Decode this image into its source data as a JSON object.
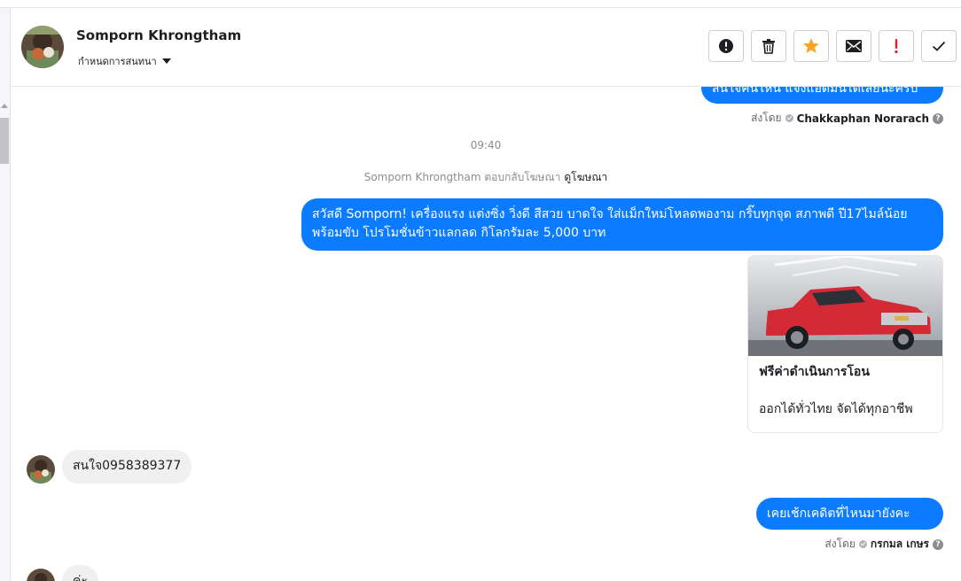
{
  "header": {
    "name": "Somporn Khrongtham",
    "assign_label": "กำหนดการสนทนา",
    "actions": [
      {
        "icon": "exclamation-circle-icon"
      },
      {
        "icon": "trash-icon"
      },
      {
        "icon": "star-icon",
        "color": "#f5a623"
      },
      {
        "icon": "envelope-icon"
      },
      {
        "icon": "exclamation-icon",
        "color": "#e02020"
      },
      {
        "icon": "checkmark-icon"
      }
    ]
  },
  "messages": {
    "top_partial": "สนใจคันไหน แจ้งแอดมินได้เลยนะครับ",
    "top_sentby_prefix": "ส่งโดย",
    "top_sentby_name": "Chakkaphan Norarach",
    "time": "09:40",
    "ad_reply_text": "Somporn Khrongtham ตอบกลับโฆษณา",
    "ad_reply_link": "ดูโฆษณา",
    "ad_message": "สวัสดี Somporn! เครื่องแรง แต่งซิ่ง วิ่งดี สีสวย บาดใจ ใส่แม็กใหม่โหลดพองาม กริ๊บทุกจุด สภาพดี ปี17ไมล์น้อย พร้อมขับ โปรโมชั่นข้าวแลกลด กิโลกรัมละ 5,000 บาท",
    "card_title": "ฟรีค่าดำเนินการโอน",
    "card_subtitle": "ออกได้ทั่วไทย จัดได้ทุกอาชีพ",
    "incoming_1": "สนใจ0958389377",
    "outgoing_2": "เคยเช้กเคดิตที่ไหนมายังคะ",
    "sentby2_prefix": "ส่งโดย",
    "sentby2_name": "กรกมล เกษร",
    "incoming_2_partial": "ค่ะ"
  },
  "colors": {
    "bubble_out": "#0b7bff",
    "bubble_in": "#f0f0f0",
    "car_red": "#d42a36"
  }
}
